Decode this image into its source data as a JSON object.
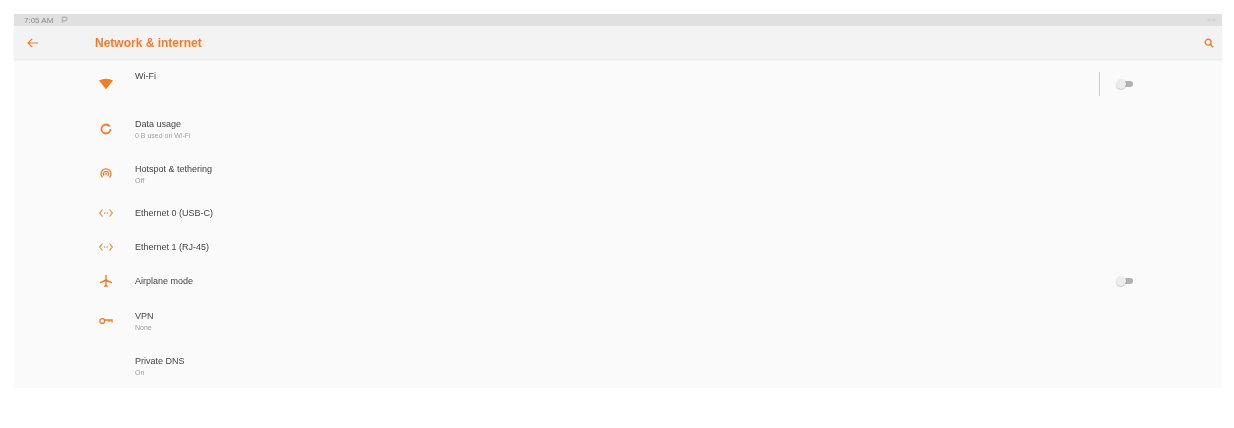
{
  "status_bar": {
    "time": "7:05 AM"
  },
  "toolbar": {
    "title": "Network & internet"
  },
  "items": [
    {
      "title": "Wi-Fi",
      "switch": {
        "on": false,
        "divider": true
      }
    },
    {
      "title": "Data usage",
      "summary": "0 B used on Wi-Fi"
    },
    {
      "title": "Hotspot & tethering",
      "summary": "Off"
    },
    {
      "title": "Ethernet 0 (USB-C)"
    },
    {
      "title": "Ethernet 1 (RJ-45)"
    },
    {
      "title": "Airplane mode",
      "switch": {
        "on": false,
        "divider": false
      }
    },
    {
      "title": "VPN",
      "summary": "None"
    },
    {
      "title": "Private DNS",
      "summary": "On"
    }
  ]
}
